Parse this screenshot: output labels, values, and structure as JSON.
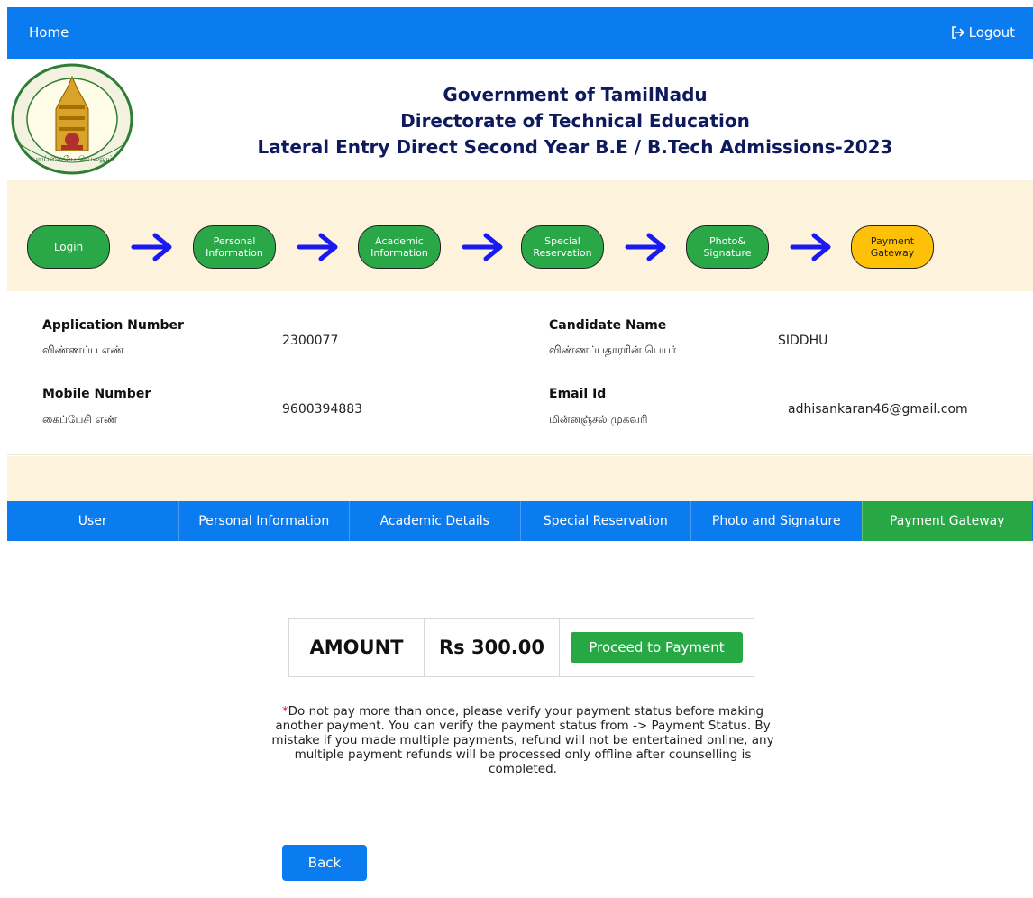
{
  "topbar": {
    "home": "Home",
    "logout": "Logout",
    "logout_icon": "sign-out-icon"
  },
  "header": {
    "line1": "Government of TamilNadu",
    "line2": "Directorate of Technical Education",
    "line3": "Lateral Entry Direct Second Year B.E / B.Tech Admissions-2023",
    "emblem_text": "வாய்மையே வெல்லும்"
  },
  "steps": [
    {
      "line1": "Login",
      "line2": ""
    },
    {
      "line1": "Personal",
      "line2": "Information"
    },
    {
      "line1": "Academic",
      "line2": "Information"
    },
    {
      "line1": "Special",
      "line2": "Reservation"
    },
    {
      "line1": "Photo&",
      "line2": "Signature"
    },
    {
      "line1": "Payment",
      "line2": "Gateway"
    }
  ],
  "info": {
    "app_no_label": "Application Number",
    "app_no_tamil": "விண்ணப்ப எண்",
    "app_no_value": "2300077",
    "name_label": "Candidate Name",
    "name_tamil": "விண்ணப்பதாரரின் பெயர்",
    "name_value": "SIDDHU",
    "mobile_label": "Mobile Number",
    "mobile_tamil": "கைப்பேசி எண்",
    "mobile_value": "9600394883",
    "email_label": "Email Id",
    "email_tamil": "மின்னஞ்சல் முகவரி",
    "email_value": "adhisankaran46@gmail.com"
  },
  "tabs": [
    "User",
    "Personal Information",
    "Academic Details",
    "Special Reservation",
    "Photo and Signature",
    "Payment Gateway"
  ],
  "payment": {
    "amount_label": "AMOUNT",
    "amount_value": "Rs 300.00",
    "button": "Proceed to Payment"
  },
  "note": {
    "star": "*",
    "text": "Do not pay more than once, please verify your payment status before making another payment. You can verify the payment status from -> Payment Status. By mistake if you made multiple payments, refund will not be entertained online, any multiple payment refunds will be processed only offline after counselling is completed."
  },
  "back": "Back",
  "colors": {
    "primary": "#0b7bf0",
    "success": "#28a745",
    "warning": "#ffc107",
    "band": "#fdf2dc",
    "title": "#0e1a5c"
  }
}
